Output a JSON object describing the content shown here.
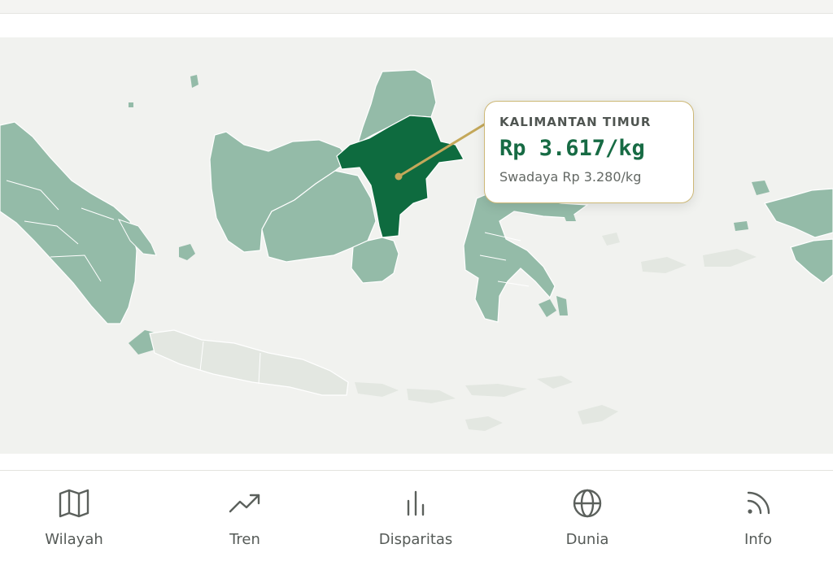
{
  "colors": {
    "map_bg": "#f1f2ef",
    "region_default": "#94bba8",
    "region_selected": "#0e6b3f",
    "region_no_data": "#e3e7e1",
    "accent_gold": "#c4a85a",
    "price_text": "#176b44"
  },
  "tooltip": {
    "region": "KALIMANTAN TIMUR",
    "price": "Rp 3.617/kg",
    "secondary": "Swadaya Rp 3.280/kg"
  },
  "nav": {
    "items": [
      {
        "label": "Wilayah",
        "icon": "map-icon"
      },
      {
        "label": "Tren",
        "icon": "trend-icon"
      },
      {
        "label": "Disparitas",
        "icon": "bar-chart-icon"
      },
      {
        "label": "Dunia",
        "icon": "globe-icon"
      },
      {
        "label": "Info",
        "icon": "rss-icon"
      }
    ]
  }
}
